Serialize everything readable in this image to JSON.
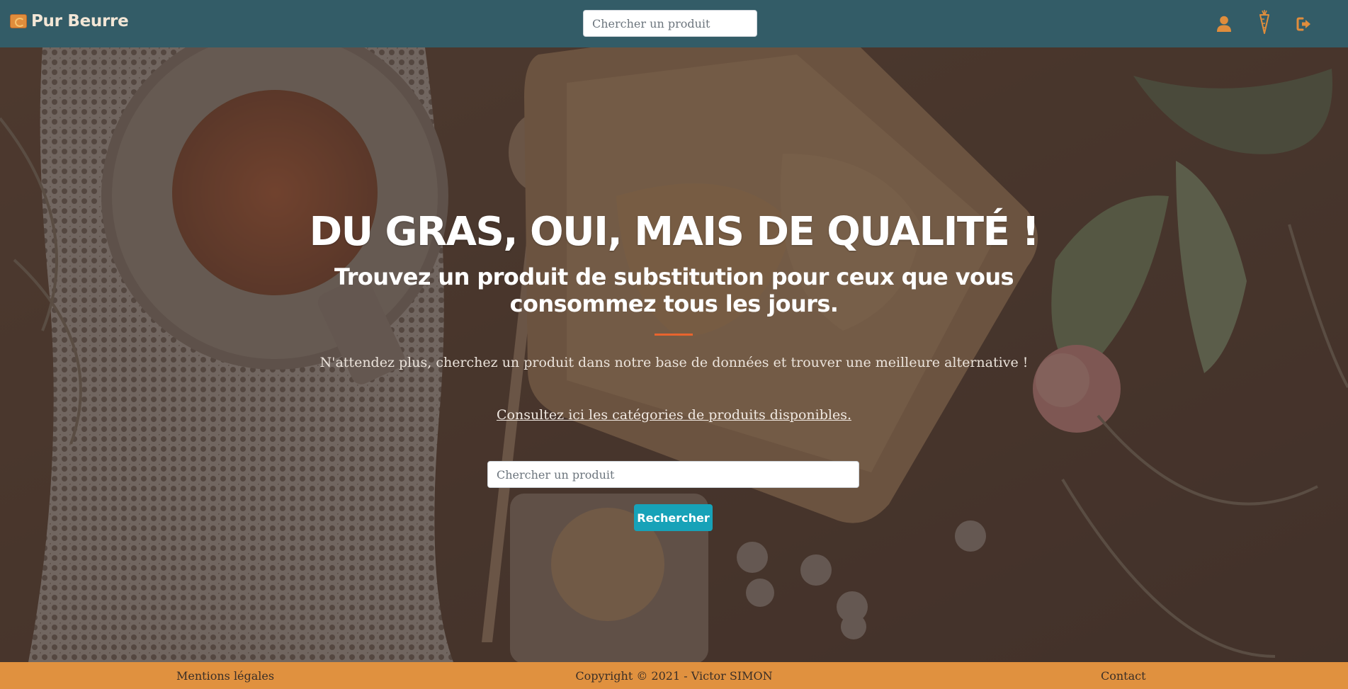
{
  "brand": {
    "name": "Pur Beurre",
    "logo_icon": "logo-icon"
  },
  "navbar": {
    "search_placeholder": "Chercher un produit",
    "icons": [
      "user-icon",
      "carrot-icon",
      "sign-out-icon"
    ],
    "icon_color": "#e08d3c",
    "background": "#335c67"
  },
  "hero": {
    "title": "DU GRAS, OUI, MAIS DE QUALITÉ !",
    "subtitle": "Trouvez un produit de substitution pour ceux que vous consommez tous les jours.",
    "text": "N'attendez plus, cherchez un produit dans notre base de données et trouver une meilleure alternative !",
    "categories_link": "Consultez ici les catégories de produits disponibles.",
    "search_placeholder": "Chercher un produit",
    "search_button": "Rechercher",
    "divider_color": "#e8642e",
    "button_color": "#17a2b8"
  },
  "footer": {
    "legal": "Mentions légales",
    "copyright": "Copyright © 2021 - Victor SIMON",
    "contact": "Contact",
    "background": "#e0913f"
  }
}
